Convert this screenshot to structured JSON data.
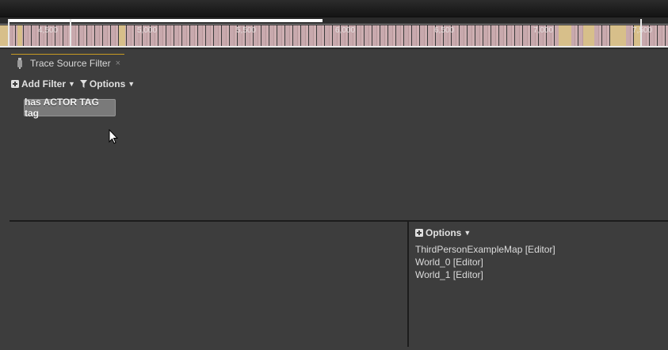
{
  "timeline": {
    "tick_labels": [
      "4,500",
      "5,000",
      "5,500",
      "6,000",
      "6,500",
      "7,000",
      "7,500"
    ]
  },
  "tab": {
    "title": "Trace Source Filter",
    "icon": "filter-source-icon",
    "close_label": "×"
  },
  "toolbar": {
    "add_filter_label": "Add Filter",
    "options_label": "Options"
  },
  "filters": [
    {
      "label": "has ACTOR TAG tag"
    }
  ],
  "worlds_panel": {
    "options_label": "Options",
    "items": [
      "ThirdPersonExampleMap [Editor]",
      "World_0 [Editor]",
      "World_1 [Editor]"
    ]
  },
  "colors": {
    "background": "#3d3d3d",
    "tab_accent": "#c79a22",
    "chip_bg": "#7a7a7a",
    "track_pink": "#c8a9ad",
    "track_gold": "#d7bf8a"
  }
}
